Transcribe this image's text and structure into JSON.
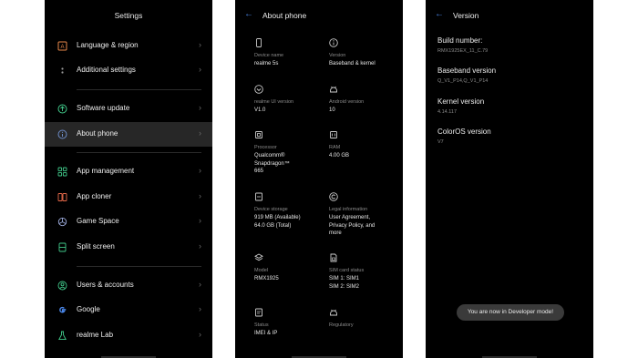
{
  "settings": {
    "title": "Settings",
    "items": [
      {
        "label": "Language & region",
        "icon": "language-icon",
        "color": "#e8884a"
      },
      {
        "label": "Additional settings",
        "icon": "dots-icon",
        "color": "#9a9a9a"
      },
      {
        "label": "Software update",
        "icon": "update-icon",
        "color": "#41c98a"
      },
      {
        "label": "About phone",
        "icon": "info-icon",
        "color": "#6d8cc7"
      },
      {
        "label": "App management",
        "icon": "apps-grid-icon",
        "color": "#41c98a"
      },
      {
        "label": "App cloner",
        "icon": "cloner-icon",
        "color": "#e86a4a"
      },
      {
        "label": "Game Space",
        "icon": "game-space-icon",
        "color": "#9aa8d8"
      },
      {
        "label": "Split screen",
        "icon": "split-screen-icon",
        "color": "#41c98a"
      },
      {
        "label": "Users & accounts",
        "icon": "user-icon",
        "color": "#41c98a"
      },
      {
        "label": "Google",
        "icon": "google-icon",
        "color": "#4a86e8"
      },
      {
        "label": "realme Lab",
        "icon": "flask-icon",
        "color": "#41c98a"
      }
    ]
  },
  "about": {
    "title": "About phone",
    "back_icon": "back-arrow-icon",
    "cells": [
      {
        "label": "Device name",
        "value": "realme 5s",
        "icon": "phone-icon"
      },
      {
        "label": "Version",
        "value": "Baseband & kernel",
        "icon": "info-icon"
      },
      {
        "label": "realme UI version",
        "value": "V1.0",
        "icon": "realme-ui-icon"
      },
      {
        "label": "Android version",
        "value": "10",
        "icon": "android-icon"
      },
      {
        "label": "Processor",
        "value": "Qualcomm® Snapdragon™ 665",
        "icon": "chip-icon"
      },
      {
        "label": "RAM",
        "value": "4.00 GB",
        "icon": "ram-icon"
      },
      {
        "label": "Device storage",
        "value": "919 MB (Available) 64.0 GB (Total)",
        "icon": "storage-icon"
      },
      {
        "label": "Legal information",
        "value": "User Agreement, Privacy Policy, and more",
        "icon": "copyright-icon"
      },
      {
        "label": "Model",
        "value": "RMX1925",
        "icon": "layers-icon"
      },
      {
        "label": "SIM card status",
        "value": "SIM 1: SIM1 SIM 2: SIM2",
        "icon": "sim-card-icon"
      },
      {
        "label": "Status",
        "value": "IMEI & IP",
        "icon": "status-icon"
      },
      {
        "label": "Regulatory",
        "value": "",
        "icon": "regulatory-icon"
      }
    ]
  },
  "version": {
    "title": "Version",
    "items": [
      {
        "label": "Build number:",
        "value": "RMX1925EX_11_C.79"
      },
      {
        "label": "Baseband version",
        "value": "Q_V1_P14,Q_V1_P14"
      },
      {
        "label": "Kernel version",
        "value": "4.14.117"
      },
      {
        "label": "ColorOS version",
        "value": "V7"
      }
    ],
    "toast": "You are now in Developer mode!"
  },
  "colors": {
    "accent": "#4a86e8",
    "active_row": "#272727"
  }
}
